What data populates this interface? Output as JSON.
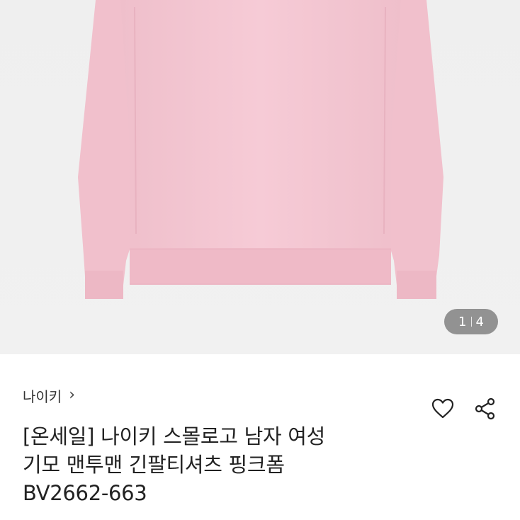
{
  "gallery": {
    "current": "1",
    "total": "4",
    "image_alt": "pink crewneck sweatshirt"
  },
  "product": {
    "brand": "나이키",
    "brand_chevron": "›",
    "title_line1": "[온세일] 나이키 스몰로고 남자 여성",
    "title_line2": "기모 맨투맨 긴팔티셔츠 핑크폼",
    "title_line3": "BV2662-663"
  },
  "icons": {
    "wishlist": "heart-icon",
    "share": "share-icon"
  },
  "colors": {
    "garment": "#f4c8d3",
    "background": "#efefef"
  }
}
